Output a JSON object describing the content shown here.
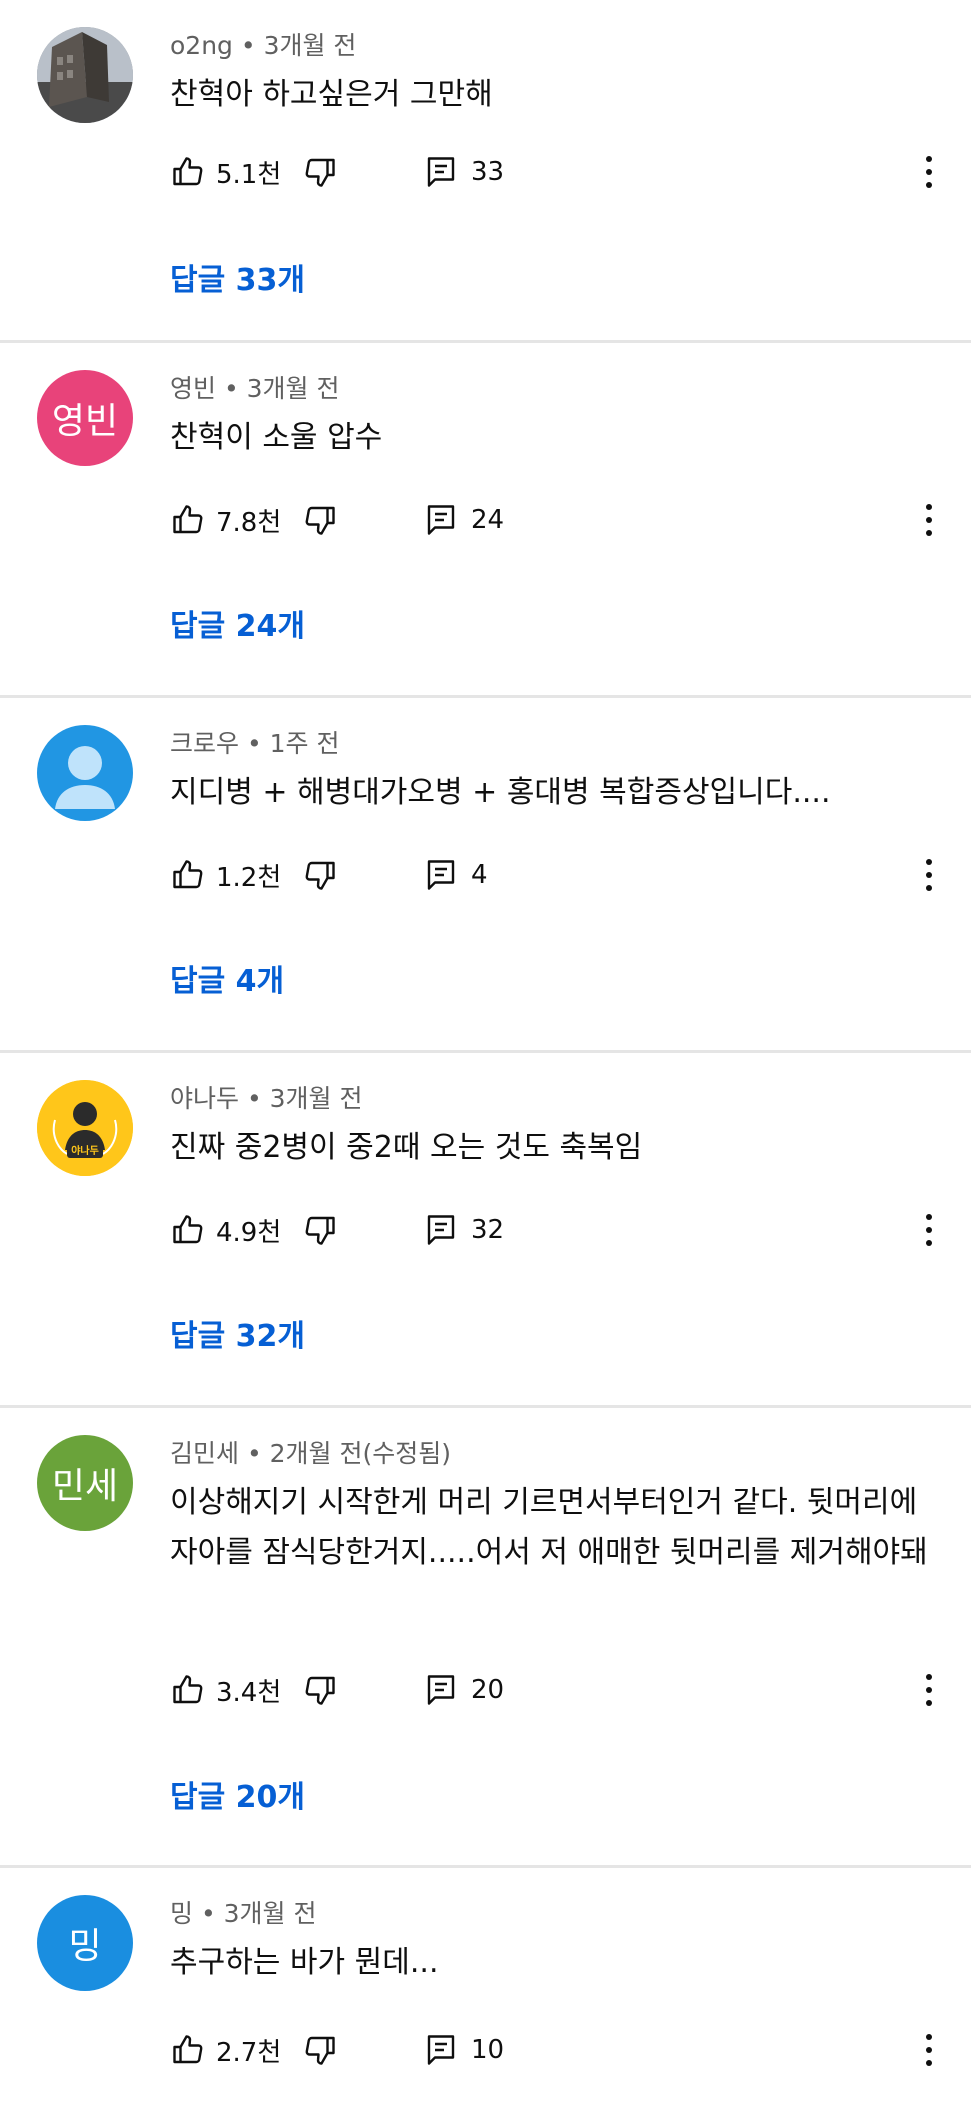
{
  "comments": [
    {
      "author": "o2ng",
      "time": "3개월 전",
      "text": "찬혁아 하고싶은거 그만해",
      "likes": "5.1천",
      "reply_count": "33",
      "replies_label": "답글 33개",
      "avatar": {
        "type": "photo",
        "bg": "#8a8f96",
        "label": ""
      }
    },
    {
      "author": "영빈",
      "time": "3개월 전",
      "text": "찬혁이 소울 압수",
      "likes": "7.8천",
      "reply_count": "24",
      "replies_label": "답글 24개",
      "avatar": {
        "type": "letters",
        "bg": "#e8437a",
        "label": "영빈"
      }
    },
    {
      "author": "크로우",
      "time": "1주 전",
      "text": "지디병 + 해병대가오병 + 홍대병  복합증상입니다....",
      "likes": "1.2천",
      "reply_count": "4",
      "replies_label": "답글 4개",
      "avatar": {
        "type": "default",
        "bg": "#2196e3",
        "label": ""
      }
    },
    {
      "author": "야나두",
      "time": "3개월 전",
      "text": "진짜 중2병이 중2때 오는 것도 축복임",
      "likes": "4.9천",
      "reply_count": "32",
      "replies_label": "답글 32개",
      "avatar": {
        "type": "logo",
        "bg": "#ffc61a",
        "label": "야나두"
      }
    },
    {
      "author": "김민세",
      "time": "2개월 전(수정됨)",
      "text": "이상해지기 시작한게 머리 기르면서부터인거 같다. 뒷머리에 자아를 잠식당한거지.....어서 저 애매한 뒷머리를 제거해야돼",
      "likes": "3.4천",
      "reply_count": "20",
      "replies_label": "답글 20개",
      "avatar": {
        "type": "letters",
        "bg": "#6aa33a",
        "label": "민세"
      }
    },
    {
      "author": "밍",
      "time": "3개월 전",
      "text": "추구하는 바가 뭔데...",
      "likes": "2.7천",
      "reply_count": "10",
      "replies_label": "",
      "avatar": {
        "type": "letters",
        "bg": "#1a8ee0",
        "label": "밍"
      }
    }
  ],
  "colors": {
    "link": "#065fd4",
    "meta": "#606060",
    "divider": "#e5e5e5"
  },
  "icons": {
    "like": "thumb-up-icon",
    "dislike": "thumb-down-icon",
    "reply": "comment-icon",
    "more": "more-vert-icon"
  }
}
